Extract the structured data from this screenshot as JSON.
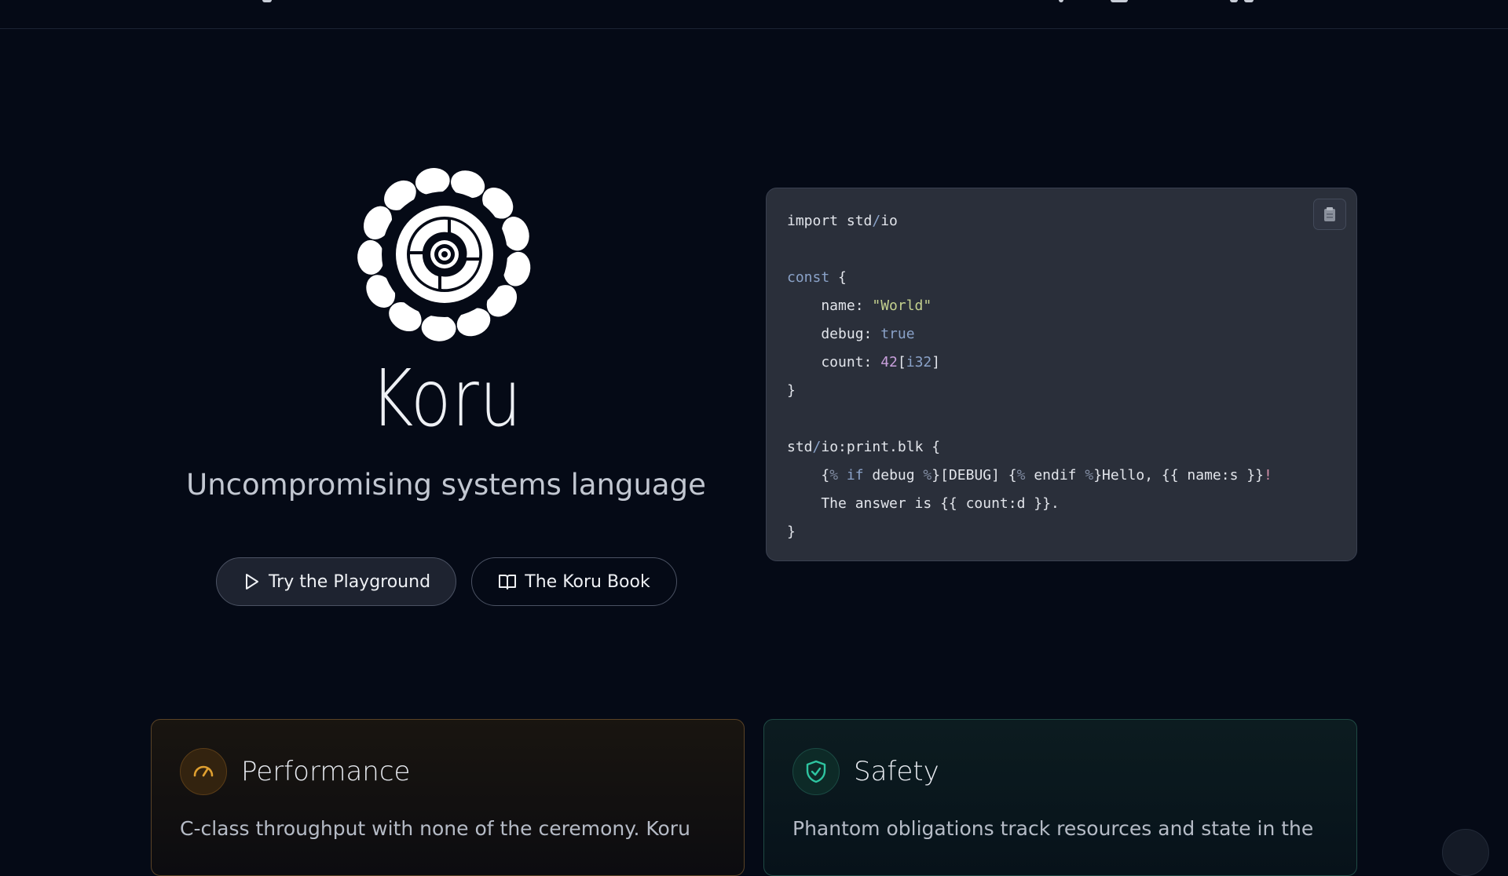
{
  "brand": {
    "name": "Koru",
    "tagline": "Uncompromising systems language"
  },
  "actions": {
    "playground_label": "Try the Playground",
    "book_label": "The Koru Book"
  },
  "code_sample": {
    "copy_icon": "clipboard-icon",
    "lines": [
      "import std/io",
      "",
      "const {",
      "    name: \"World\"",
      "    debug: true",
      "    count: 42[i32]",
      "}",
      "",
      "std/io:print.blk {",
      "    {% if debug %}[DEBUG] {% endif %}Hello, {{ name:s }}!",
      "    The answer is {{ count:d }}.",
      "}"
    ]
  },
  "features": [
    {
      "title": "Performance",
      "icon": "gauge-icon",
      "accent": "#e0a030",
      "description": "C-class throughput with none of the ceremony. Koru"
    },
    {
      "title": "Safety",
      "icon": "shield-check-icon",
      "accent": "#2ec4a0",
      "description": "Phantom obligations track resources and state in the"
    }
  ]
}
